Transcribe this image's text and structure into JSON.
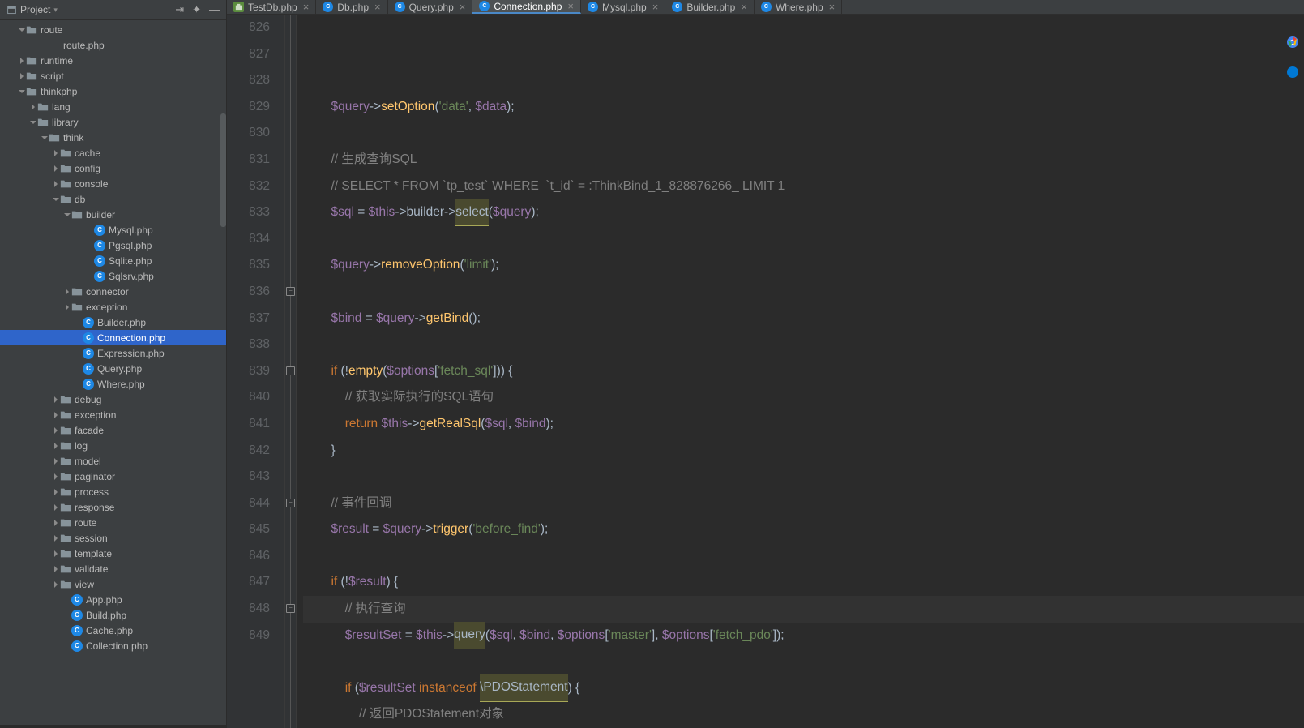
{
  "sidebar": {
    "title": "Project",
    "tree": [
      {
        "indent": 1,
        "arrow": "down",
        "icon": "folder",
        "label": "route"
      },
      {
        "indent": 3,
        "arrow": "",
        "icon": "file",
        "label": "route.php"
      },
      {
        "indent": 1,
        "arrow": "right",
        "icon": "folder",
        "label": "runtime"
      },
      {
        "indent": 1,
        "arrow": "right",
        "icon": "folder",
        "label": "script"
      },
      {
        "indent": 1,
        "arrow": "down",
        "icon": "folder",
        "label": "thinkphp"
      },
      {
        "indent": 2,
        "arrow": "right",
        "icon": "folder",
        "label": "lang"
      },
      {
        "indent": 2,
        "arrow": "down",
        "icon": "folder",
        "label": "library"
      },
      {
        "indent": 3,
        "arrow": "down",
        "icon": "folder",
        "label": "think"
      },
      {
        "indent": 4,
        "arrow": "right",
        "icon": "folder",
        "label": "cache"
      },
      {
        "indent": 4,
        "arrow": "right",
        "icon": "folder",
        "label": "config"
      },
      {
        "indent": 4,
        "arrow": "right",
        "icon": "folder",
        "label": "console"
      },
      {
        "indent": 4,
        "arrow": "down",
        "icon": "folder",
        "label": "db"
      },
      {
        "indent": 5,
        "arrow": "down",
        "icon": "folder",
        "label": "builder"
      },
      {
        "indent": 7,
        "arrow": "",
        "icon": "php",
        "label": "Mysql.php"
      },
      {
        "indent": 7,
        "arrow": "",
        "icon": "php",
        "label": "Pgsql.php"
      },
      {
        "indent": 7,
        "arrow": "",
        "icon": "php",
        "label": "Sqlite.php"
      },
      {
        "indent": 7,
        "arrow": "",
        "icon": "php",
        "label": "Sqlsrv.php"
      },
      {
        "indent": 5,
        "arrow": "right",
        "icon": "folder",
        "label": "connector"
      },
      {
        "indent": 5,
        "arrow": "right",
        "icon": "folder",
        "label": "exception"
      },
      {
        "indent": 6,
        "arrow": "",
        "icon": "php",
        "label": "Builder.php"
      },
      {
        "indent": 6,
        "arrow": "",
        "icon": "php",
        "label": "Connection.php",
        "selected": true
      },
      {
        "indent": 6,
        "arrow": "",
        "icon": "php",
        "label": "Expression.php"
      },
      {
        "indent": 6,
        "arrow": "",
        "icon": "php",
        "label": "Query.php"
      },
      {
        "indent": 6,
        "arrow": "",
        "icon": "php",
        "label": "Where.php"
      },
      {
        "indent": 4,
        "arrow": "right",
        "icon": "folder",
        "label": "debug"
      },
      {
        "indent": 4,
        "arrow": "right",
        "icon": "folder",
        "label": "exception"
      },
      {
        "indent": 4,
        "arrow": "right",
        "icon": "folder",
        "label": "facade"
      },
      {
        "indent": 4,
        "arrow": "right",
        "icon": "folder",
        "label": "log"
      },
      {
        "indent": 4,
        "arrow": "right",
        "icon": "folder",
        "label": "model"
      },
      {
        "indent": 4,
        "arrow": "right",
        "icon": "folder",
        "label": "paginator"
      },
      {
        "indent": 4,
        "arrow": "right",
        "icon": "folder",
        "label": "process"
      },
      {
        "indent": 4,
        "arrow": "right",
        "icon": "folder",
        "label": "response"
      },
      {
        "indent": 4,
        "arrow": "right",
        "icon": "folder",
        "label": "route"
      },
      {
        "indent": 4,
        "arrow": "right",
        "icon": "folder",
        "label": "session"
      },
      {
        "indent": 4,
        "arrow": "right",
        "icon": "folder",
        "label": "template"
      },
      {
        "indent": 4,
        "arrow": "right",
        "icon": "folder",
        "label": "validate"
      },
      {
        "indent": 4,
        "arrow": "right",
        "icon": "folder",
        "label": "view"
      },
      {
        "indent": 5,
        "arrow": "",
        "icon": "php",
        "label": "App.php"
      },
      {
        "indent": 5,
        "arrow": "",
        "icon": "php",
        "label": "Build.php"
      },
      {
        "indent": 5,
        "arrow": "",
        "icon": "php",
        "label": "Cache.php"
      },
      {
        "indent": 5,
        "arrow": "",
        "icon": "php",
        "label": "Collection.php"
      }
    ]
  },
  "tabs": [
    {
      "label": "TestDb.php",
      "icon": "test"
    },
    {
      "label": "Db.php",
      "icon": "php"
    },
    {
      "label": "Query.php",
      "icon": "php"
    },
    {
      "label": "Connection.php",
      "icon": "php",
      "active": true
    },
    {
      "label": "Mysql.php",
      "icon": "php"
    },
    {
      "label": "Builder.php",
      "icon": "php"
    },
    {
      "label": "Where.php",
      "icon": "php"
    }
  ],
  "lines": {
    "start": 826,
    "end": 849,
    "current": 845,
    "folds": [
      836,
      839,
      844,
      848
    ]
  },
  "code": {
    "l826": {
      "pre": "        ",
      "t": [
        [
          "var",
          "$query"
        ],
        [
          "op",
          "->"
        ],
        [
          "fn",
          "setOption"
        ],
        [
          "op",
          "("
        ],
        [
          "str",
          "'data'"
        ],
        [
          "op",
          ", "
        ],
        [
          "var",
          "$data"
        ],
        [
          "op",
          ");"
        ]
      ]
    },
    "l827": {
      "pre": "",
      "t": []
    },
    "l828": {
      "pre": "        ",
      "t": [
        [
          "cmt",
          "// 生成查询SQL"
        ]
      ]
    },
    "l829": {
      "pre": "        ",
      "t": [
        [
          "cmt",
          "// SELECT * FROM `tp_test` WHERE  `t_id` = :ThinkBind_1_828876266_ LIMIT 1"
        ]
      ]
    },
    "l830": {
      "pre": "        ",
      "t": [
        [
          "var",
          "$sql"
        ],
        [
          "op",
          " = "
        ],
        [
          "var",
          "$this"
        ],
        [
          "op",
          "->"
        ],
        [
          "op",
          "builder->"
        ],
        [
          "hl",
          "select"
        ],
        [
          "op",
          "("
        ],
        [
          "var",
          "$query"
        ],
        [
          "op",
          ");"
        ]
      ]
    },
    "l831": {
      "pre": "",
      "t": []
    },
    "l832": {
      "pre": "        ",
      "t": [
        [
          "var",
          "$query"
        ],
        [
          "op",
          "->"
        ],
        [
          "fn",
          "removeOption"
        ],
        [
          "op",
          "("
        ],
        [
          "str",
          "'limit'"
        ],
        [
          "op",
          ");"
        ]
      ]
    },
    "l833": {
      "pre": "",
      "t": []
    },
    "l834": {
      "pre": "        ",
      "t": [
        [
          "var",
          "$bind"
        ],
        [
          "op",
          " = "
        ],
        [
          "var",
          "$query"
        ],
        [
          "op",
          "->"
        ],
        [
          "fn",
          "getBind"
        ],
        [
          "op",
          "();"
        ]
      ]
    },
    "l835": {
      "pre": "",
      "t": []
    },
    "l836": {
      "pre": "        ",
      "t": [
        [
          "kw",
          "if "
        ],
        [
          "op",
          "(!"
        ],
        [
          "fn",
          "empty"
        ],
        [
          "op",
          "("
        ],
        [
          "var",
          "$options"
        ],
        [
          "op",
          "["
        ],
        [
          "str",
          "'fetch_sql'"
        ],
        [
          "op",
          "])) {"
        ]
      ]
    },
    "l837": {
      "pre": "            ",
      "t": [
        [
          "cmt",
          "// 获取实际执行的SQL语句"
        ]
      ]
    },
    "l838": {
      "pre": "            ",
      "t": [
        [
          "kw",
          "return "
        ],
        [
          "var",
          "$this"
        ],
        [
          "op",
          "->"
        ],
        [
          "fn",
          "getRealSql"
        ],
        [
          "op",
          "("
        ],
        [
          "var",
          "$sql"
        ],
        [
          "op",
          ", "
        ],
        [
          "var",
          "$bind"
        ],
        [
          "op",
          ");"
        ]
      ]
    },
    "l839": {
      "pre": "        ",
      "t": [
        [
          "op",
          "}"
        ]
      ]
    },
    "l840": {
      "pre": "",
      "t": []
    },
    "l841": {
      "pre": "        ",
      "t": [
        [
          "cmt",
          "// 事件回调"
        ]
      ]
    },
    "l842": {
      "pre": "        ",
      "t": [
        [
          "var",
          "$result"
        ],
        [
          "op",
          " = "
        ],
        [
          "var",
          "$query"
        ],
        [
          "op",
          "->"
        ],
        [
          "fn",
          "trigger"
        ],
        [
          "op",
          "("
        ],
        [
          "str",
          "'before_find'"
        ],
        [
          "op",
          ");"
        ]
      ]
    },
    "l843": {
      "pre": "",
      "t": []
    },
    "l844": {
      "pre": "        ",
      "t": [
        [
          "kw",
          "if "
        ],
        [
          "op",
          "(!"
        ],
        [
          "var",
          "$result"
        ],
        [
          "op",
          ") {"
        ]
      ]
    },
    "l845": {
      "pre": "            ",
      "t": [
        [
          "cmt",
          "// 执行查询"
        ]
      ]
    },
    "l846": {
      "pre": "            ",
      "t": [
        [
          "var",
          "$resultSet"
        ],
        [
          "op",
          " = "
        ],
        [
          "var",
          "$this"
        ],
        [
          "op",
          "->"
        ],
        [
          "hl",
          "query"
        ],
        [
          "op",
          "("
        ],
        [
          "var",
          "$sql"
        ],
        [
          "op",
          ", "
        ],
        [
          "var",
          "$bind"
        ],
        [
          "op",
          ", "
        ],
        [
          "var",
          "$options"
        ],
        [
          "op",
          "["
        ],
        [
          "str",
          "'master'"
        ],
        [
          "op",
          "], "
        ],
        [
          "var",
          "$options"
        ],
        [
          "op",
          "["
        ],
        [
          "str",
          "'fetch_pdo'"
        ],
        [
          "op",
          "]);"
        ]
      ]
    },
    "l847": {
      "pre": "",
      "t": []
    },
    "l848": {
      "pre": "            ",
      "t": [
        [
          "kw",
          "if "
        ],
        [
          "op",
          "("
        ],
        [
          "var",
          "$resultSet"
        ],
        [
          "op",
          " "
        ],
        [
          "kw",
          "instanceof"
        ],
        [
          "op",
          " "
        ],
        [
          "hl",
          "\\PDOStatement"
        ],
        [
          "op",
          ") {"
        ]
      ]
    },
    "l849": {
      "pre": "                ",
      "t": [
        [
          "cmt",
          "// 返回PDOStatement对象"
        ]
      ]
    }
  }
}
